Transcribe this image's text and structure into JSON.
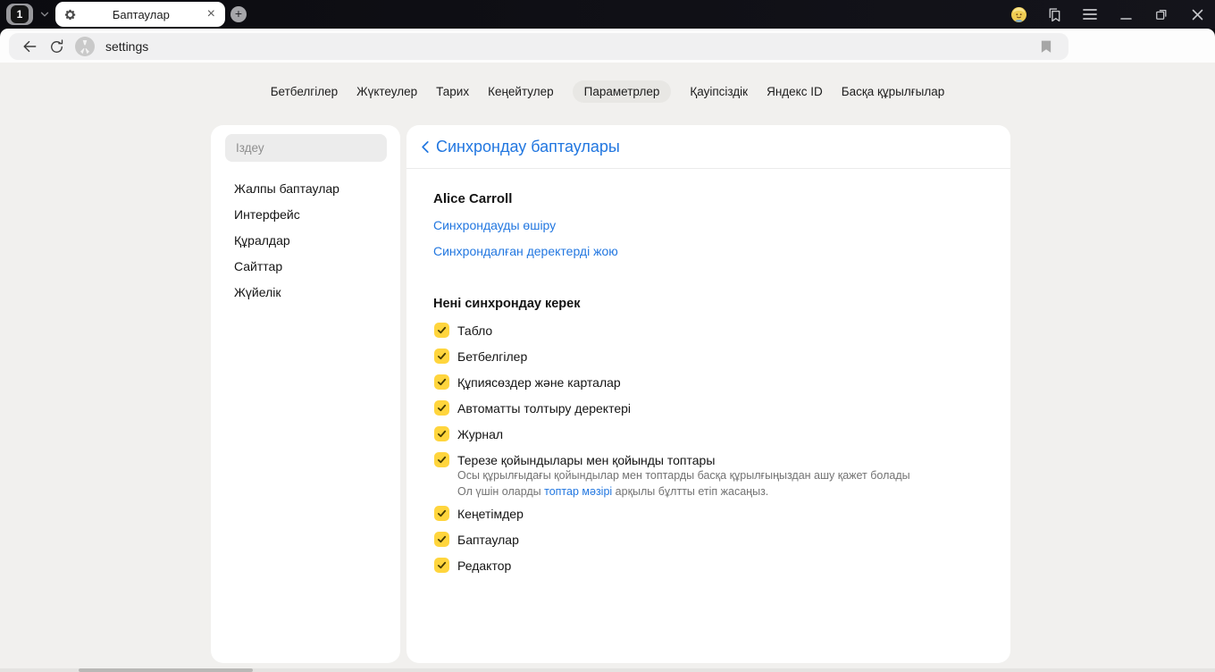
{
  "titlebar": {
    "tab_count": "1",
    "tab_title": "Баптаулар"
  },
  "icons": {
    "close_glyph": "×",
    "plus_glyph": "+",
    "dots_glyph": "⋮"
  },
  "toolbar": {
    "url": "settings",
    "page_title": "Баптаулар"
  },
  "nav": {
    "tabs": [
      {
        "label": "Бетбелгілер",
        "active": false
      },
      {
        "label": "Жүктеулер",
        "active": false
      },
      {
        "label": "Тарих",
        "active": false
      },
      {
        "label": "Кеңейтулер",
        "active": false
      },
      {
        "label": "Параметрлер",
        "active": true
      },
      {
        "label": "Қауіпсіздік",
        "active": false
      },
      {
        "label": "Яндекс ID",
        "active": false
      },
      {
        "label": "Басқа құрылғылар",
        "active": false
      }
    ]
  },
  "sidebar": {
    "search_placeholder": "Іздеу",
    "items": [
      {
        "label": "Жалпы баптаулар"
      },
      {
        "label": "Интерфейс"
      },
      {
        "label": "Құралдар"
      },
      {
        "label": "Сайттар"
      },
      {
        "label": "Жүйелік"
      }
    ]
  },
  "main": {
    "heading": "Синхрондау баптаулары",
    "account_name": "Alice Carroll",
    "disable_sync_link": "Синхрондауды өшіру",
    "delete_data_link": "Синхрондалған деректерді жою",
    "section_title": "Нені синхрондау керек",
    "sync_items": [
      {
        "label": "Табло",
        "checked": true
      },
      {
        "label": "Бетбелгілер",
        "checked": true
      },
      {
        "label": "Құпиясөздер және карталар",
        "checked": true
      },
      {
        "label": "Автоматты толтыру деректері",
        "checked": true
      },
      {
        "label": "Журнал",
        "checked": true
      },
      {
        "label": "Терезе қойындылары мен қойынды топтары",
        "checked": true,
        "desc_line1": "Осы құрылғыдағы қойындылар мен топтарды басқа құрылғыңыздан ашу қажет болады",
        "desc_line2_prefix": "Ол үшін оларды ",
        "desc_link": "топтар мәзірі",
        "desc_line2_suffix": " арқылы бұлтты етіп жасаңыз."
      },
      {
        "label": "Кеңетімдер",
        "checked": true
      },
      {
        "label": "Баптаулар",
        "checked": true
      },
      {
        "label": "Редактор",
        "checked": true
      }
    ]
  },
  "colors": {
    "accent_blue": "#2277e0",
    "checkbox_yellow": "#ffd53d",
    "protect_red": "#e02b33",
    "extension_purple": "#9a6fe0",
    "frame_dark": "#0d0d11"
  }
}
